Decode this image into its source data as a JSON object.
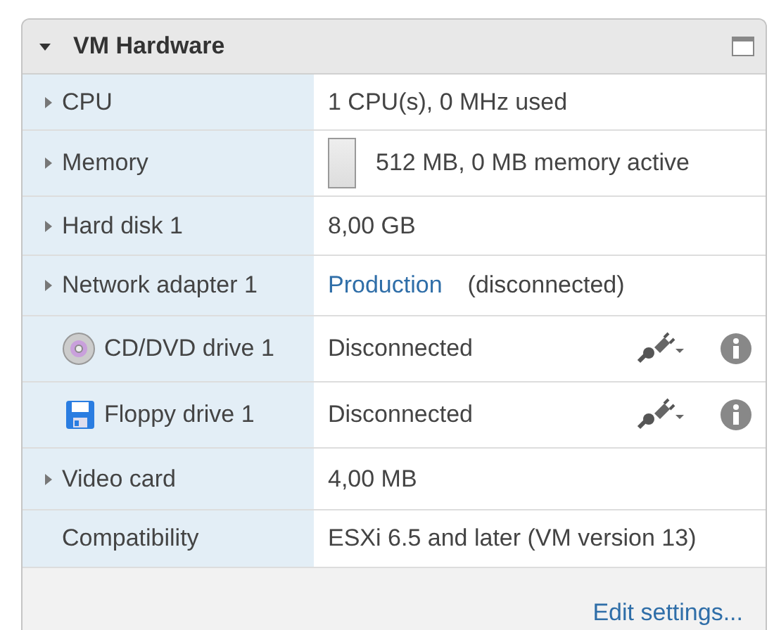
{
  "panel": {
    "title": "VM Hardware",
    "expanded": true
  },
  "rows": [
    {
      "kind": "expandable",
      "label": "CPU",
      "value": "1 CPU(s), 0 MHz used"
    },
    {
      "kind": "memory",
      "label": "Memory",
      "value": "512 MB, 0 MB memory active"
    },
    {
      "kind": "expandable",
      "label": "Hard disk 1",
      "value": "8,00 GB"
    },
    {
      "kind": "network",
      "label": "Network adapter 1",
      "link": "Production",
      "value": "(disconnected)"
    },
    {
      "kind": "disc",
      "label": "CD/DVD drive 1",
      "value": "Disconnected"
    },
    {
      "kind": "floppy",
      "label": "Floppy drive 1",
      "value": "Disconnected"
    },
    {
      "kind": "expandable",
      "label": "Video card",
      "value": "4,00 MB"
    },
    {
      "kind": "plain",
      "label": "Compatibility",
      "value": "ESXi 6.5 and later (VM version 13)"
    }
  ],
  "footer": {
    "link": "Edit settings..."
  }
}
